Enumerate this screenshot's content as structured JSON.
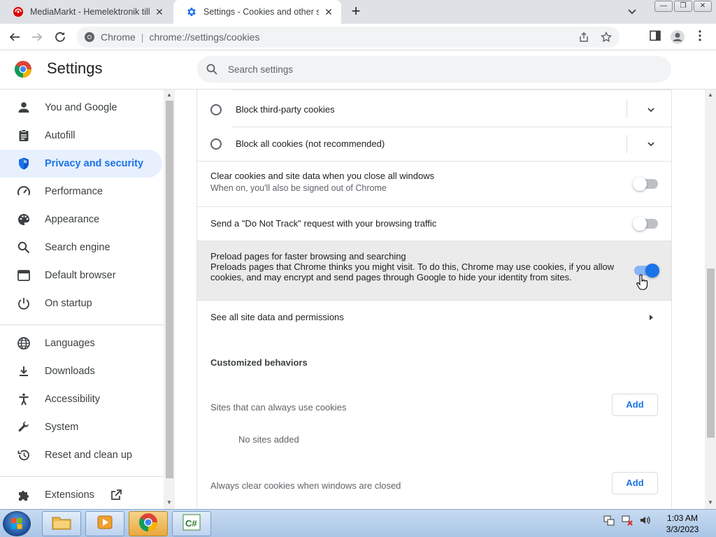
{
  "browser": {
    "tabs": [
      {
        "title": "MediaMarkt - Hemelektronik till",
        "icon": "mediamarkt-icon"
      },
      {
        "title": "Settings - Cookies and other site",
        "icon": "gear-icon",
        "active": true
      }
    ],
    "omnibox": {
      "chip": "Chrome",
      "separator": "|",
      "url": "chrome://settings/cookies"
    }
  },
  "header": {
    "title": "Settings",
    "search_placeholder": "Search settings"
  },
  "sidebar": {
    "items": [
      {
        "label": "You and Google",
        "icon": "person-icon"
      },
      {
        "label": "Autofill",
        "icon": "clipboard-icon"
      },
      {
        "label": "Privacy and security",
        "icon": "shield-icon",
        "active": true
      },
      {
        "label": "Performance",
        "icon": "speedometer-icon"
      },
      {
        "label": "Appearance",
        "icon": "palette-icon"
      },
      {
        "label": "Search engine",
        "icon": "search-icon"
      },
      {
        "label": "Default browser",
        "icon": "browser-window-icon"
      },
      {
        "label": "On startup",
        "icon": "power-icon"
      },
      {
        "label": "Languages",
        "icon": "globe-icon"
      },
      {
        "label": "Downloads",
        "icon": "download-icon"
      },
      {
        "label": "Accessibility",
        "icon": "accessibility-icon"
      },
      {
        "label": "System",
        "icon": "wrench-icon"
      },
      {
        "label": "Reset and clean up",
        "icon": "history-icon"
      },
      {
        "label": "Extensions",
        "icon": "puzzle-icon"
      }
    ]
  },
  "main": {
    "radios": [
      {
        "label": "Block third-party cookies",
        "checked": false
      },
      {
        "label": "Block all cookies (not recommended)",
        "checked": false
      }
    ],
    "toggles": [
      {
        "label": "Clear cookies and site data when you close all windows",
        "sub": "When on, you'll also be signed out of Chrome",
        "on": false
      },
      {
        "label": "Send a \"Do Not Track\" request with your browsing traffic",
        "sub": "",
        "on": false
      },
      {
        "label": "Preload pages for faster browsing and searching",
        "sub": "Preloads pages that Chrome thinks you might visit. To do this, Chrome may use cookies, if you allow cookies, and may encrypt and send pages through Google to hide your identity from sites.",
        "on": true
      }
    ],
    "see_all": "See all site data and permissions",
    "customized_title": "Customized behaviors",
    "allow_label": "Sites that can always use cookies",
    "add_label": "Add",
    "no_sites": "No sites added",
    "clear_label": "Always clear cookies when windows are closed"
  },
  "taskbar": {
    "time": "1:03 AM",
    "date": "3/3/2023"
  },
  "colors": {
    "accent": "#1a73e8",
    "active_nav_bg": "#e8f0fe"
  }
}
